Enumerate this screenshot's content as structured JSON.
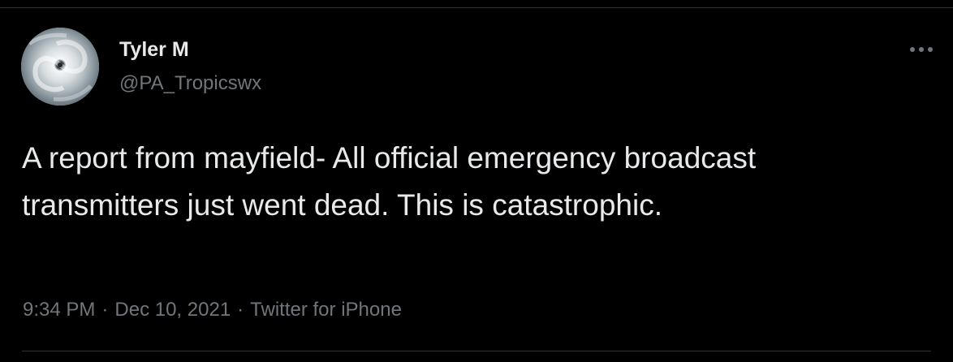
{
  "tweet": {
    "author": {
      "display_name": "Tyler M",
      "handle": "@PA_Tropicswx",
      "avatar_icon": "hurricane-satellite-avatar"
    },
    "more_icon": "more-options-icon",
    "text": "A report from mayfield- All official emergency broadcast transmitters just went dead. This is catastrophic.",
    "time": "9:34 PM",
    "date": "Dec 10, 2021",
    "separator": "·",
    "source": "Twitter for iPhone"
  },
  "colors": {
    "background": "#000000",
    "primary_text": "#e7e9ea",
    "secondary_text": "#71767b",
    "divider": "#2f3336"
  }
}
